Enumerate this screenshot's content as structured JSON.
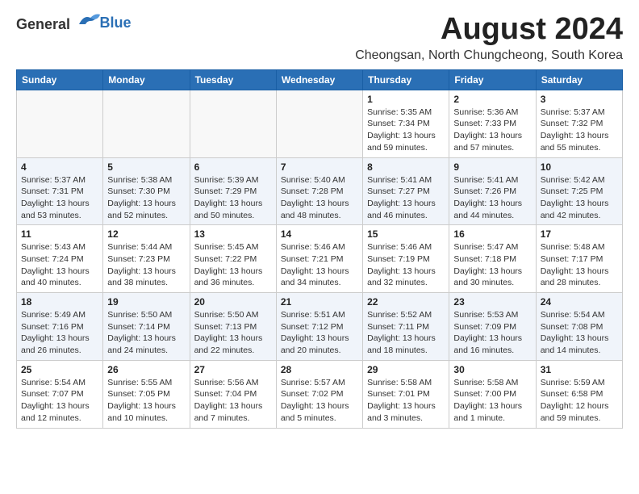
{
  "logo": {
    "general": "General",
    "blue": "Blue"
  },
  "title": {
    "month_year": "August 2024",
    "location": "Cheongsan, North Chungcheong, South Korea"
  },
  "headers": [
    "Sunday",
    "Monday",
    "Tuesday",
    "Wednesday",
    "Thursday",
    "Friday",
    "Saturday"
  ],
  "weeks": [
    [
      {
        "day": "",
        "info": ""
      },
      {
        "day": "",
        "info": ""
      },
      {
        "day": "",
        "info": ""
      },
      {
        "day": "",
        "info": ""
      },
      {
        "day": "1",
        "info": "Sunrise: 5:35 AM\nSunset: 7:34 PM\nDaylight: 13 hours\nand 59 minutes."
      },
      {
        "day": "2",
        "info": "Sunrise: 5:36 AM\nSunset: 7:33 PM\nDaylight: 13 hours\nand 57 minutes."
      },
      {
        "day": "3",
        "info": "Sunrise: 5:37 AM\nSunset: 7:32 PM\nDaylight: 13 hours\nand 55 minutes."
      }
    ],
    [
      {
        "day": "4",
        "info": "Sunrise: 5:37 AM\nSunset: 7:31 PM\nDaylight: 13 hours\nand 53 minutes."
      },
      {
        "day": "5",
        "info": "Sunrise: 5:38 AM\nSunset: 7:30 PM\nDaylight: 13 hours\nand 52 minutes."
      },
      {
        "day": "6",
        "info": "Sunrise: 5:39 AM\nSunset: 7:29 PM\nDaylight: 13 hours\nand 50 minutes."
      },
      {
        "day": "7",
        "info": "Sunrise: 5:40 AM\nSunset: 7:28 PM\nDaylight: 13 hours\nand 48 minutes."
      },
      {
        "day": "8",
        "info": "Sunrise: 5:41 AM\nSunset: 7:27 PM\nDaylight: 13 hours\nand 46 minutes."
      },
      {
        "day": "9",
        "info": "Sunrise: 5:41 AM\nSunset: 7:26 PM\nDaylight: 13 hours\nand 44 minutes."
      },
      {
        "day": "10",
        "info": "Sunrise: 5:42 AM\nSunset: 7:25 PM\nDaylight: 13 hours\nand 42 minutes."
      }
    ],
    [
      {
        "day": "11",
        "info": "Sunrise: 5:43 AM\nSunset: 7:24 PM\nDaylight: 13 hours\nand 40 minutes."
      },
      {
        "day": "12",
        "info": "Sunrise: 5:44 AM\nSunset: 7:23 PM\nDaylight: 13 hours\nand 38 minutes."
      },
      {
        "day": "13",
        "info": "Sunrise: 5:45 AM\nSunset: 7:22 PM\nDaylight: 13 hours\nand 36 minutes."
      },
      {
        "day": "14",
        "info": "Sunrise: 5:46 AM\nSunset: 7:21 PM\nDaylight: 13 hours\nand 34 minutes."
      },
      {
        "day": "15",
        "info": "Sunrise: 5:46 AM\nSunset: 7:19 PM\nDaylight: 13 hours\nand 32 minutes."
      },
      {
        "day": "16",
        "info": "Sunrise: 5:47 AM\nSunset: 7:18 PM\nDaylight: 13 hours\nand 30 minutes."
      },
      {
        "day": "17",
        "info": "Sunrise: 5:48 AM\nSunset: 7:17 PM\nDaylight: 13 hours\nand 28 minutes."
      }
    ],
    [
      {
        "day": "18",
        "info": "Sunrise: 5:49 AM\nSunset: 7:16 PM\nDaylight: 13 hours\nand 26 minutes."
      },
      {
        "day": "19",
        "info": "Sunrise: 5:50 AM\nSunset: 7:14 PM\nDaylight: 13 hours\nand 24 minutes."
      },
      {
        "day": "20",
        "info": "Sunrise: 5:50 AM\nSunset: 7:13 PM\nDaylight: 13 hours\nand 22 minutes."
      },
      {
        "day": "21",
        "info": "Sunrise: 5:51 AM\nSunset: 7:12 PM\nDaylight: 13 hours\nand 20 minutes."
      },
      {
        "day": "22",
        "info": "Sunrise: 5:52 AM\nSunset: 7:11 PM\nDaylight: 13 hours\nand 18 minutes."
      },
      {
        "day": "23",
        "info": "Sunrise: 5:53 AM\nSunset: 7:09 PM\nDaylight: 13 hours\nand 16 minutes."
      },
      {
        "day": "24",
        "info": "Sunrise: 5:54 AM\nSunset: 7:08 PM\nDaylight: 13 hours\nand 14 minutes."
      }
    ],
    [
      {
        "day": "25",
        "info": "Sunrise: 5:54 AM\nSunset: 7:07 PM\nDaylight: 13 hours\nand 12 minutes."
      },
      {
        "day": "26",
        "info": "Sunrise: 5:55 AM\nSunset: 7:05 PM\nDaylight: 13 hours\nand 10 minutes."
      },
      {
        "day": "27",
        "info": "Sunrise: 5:56 AM\nSunset: 7:04 PM\nDaylight: 13 hours\nand 7 minutes."
      },
      {
        "day": "28",
        "info": "Sunrise: 5:57 AM\nSunset: 7:02 PM\nDaylight: 13 hours\nand 5 minutes."
      },
      {
        "day": "29",
        "info": "Sunrise: 5:58 AM\nSunset: 7:01 PM\nDaylight: 13 hours\nand 3 minutes."
      },
      {
        "day": "30",
        "info": "Sunrise: 5:58 AM\nSunset: 7:00 PM\nDaylight: 13 hours\nand 1 minute."
      },
      {
        "day": "31",
        "info": "Sunrise: 5:59 AM\nSunset: 6:58 PM\nDaylight: 12 hours\nand 59 minutes."
      }
    ]
  ]
}
